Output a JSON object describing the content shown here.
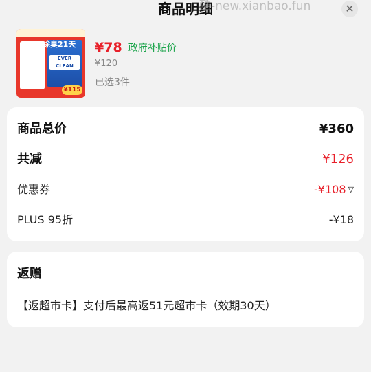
{
  "header": {
    "title": "商品明细",
    "watermark": "酷-new.xianbao.fun",
    "close_icon": "close-icon"
  },
  "product": {
    "thumbnail_icon": "cat-litter-product-image",
    "thumb_headline": "除臭21天",
    "thumb_box_label": "EVER CLEAN",
    "thumb_price_tag": "¥115",
    "price": "¥78",
    "subsidy_label": "政府补贴价",
    "original_price": "¥120",
    "quantity": "已选3件"
  },
  "summary": {
    "total_label": "商品总价",
    "total_value": "¥360",
    "reduce_label": "共减",
    "reduce_value": "¥126",
    "coupon_label": "优惠券",
    "coupon_value": "-¥108",
    "plus_label": "PLUS 95折",
    "plus_value": "-¥18"
  },
  "gift": {
    "title": "返赠",
    "text": "【返超市卡】支付后最高返51元超市卡（效期30天）"
  },
  "colors": {
    "accent_red": "#e8202a",
    "subsidy_green": "#1aa34a",
    "background": "#f2f2f2"
  }
}
